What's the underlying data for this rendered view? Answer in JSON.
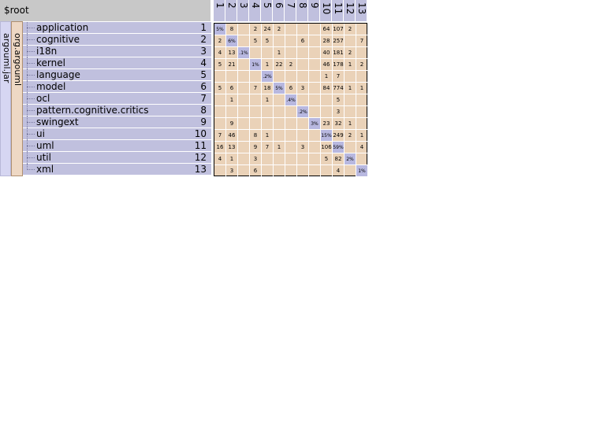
{
  "root_label": "$root",
  "jar_label": "argouml.jar",
  "package_label": "org.argouml",
  "modules": [
    {
      "name": "application",
      "index": "1"
    },
    {
      "name": "cognitive",
      "index": "2"
    },
    {
      "name": "i18n",
      "index": "3"
    },
    {
      "name": "kernel",
      "index": "4"
    },
    {
      "name": "language",
      "index": "5"
    },
    {
      "name": "model",
      "index": "6"
    },
    {
      "name": "ocl",
      "index": "7"
    },
    {
      "name": "pattern.cognitive.critics",
      "index": "8"
    },
    {
      "name": "swingext",
      "index": "9"
    },
    {
      "name": "ui",
      "index": "10"
    },
    {
      "name": "uml",
      "index": "11"
    },
    {
      "name": "util",
      "index": "12"
    },
    {
      "name": "xml",
      "index": "13"
    }
  ],
  "column_headers": [
    "1",
    "2",
    "3",
    "4",
    "5",
    "6",
    "7",
    "8",
    "9",
    "10",
    "11",
    "12",
    "13"
  ],
  "matrix": [
    [
      "5%",
      "8",
      "",
      "2",
      "24",
      "2",
      "",
      "",
      "",
      "64",
      "107",
      "2",
      ""
    ],
    [
      "2",
      "6%",
      "",
      "5",
      "5",
      "",
      "",
      "6",
      "",
      "28",
      "257",
      "",
      "7"
    ],
    [
      "4",
      "13",
      ".1%",
      "",
      "",
      "1",
      "",
      "",
      "",
      "40",
      "181",
      "2",
      ""
    ],
    [
      "5",
      "21",
      "",
      "1%",
      "1",
      "22",
      "2",
      "",
      "",
      "46",
      "178",
      "1",
      "2"
    ],
    [
      "",
      "",
      "",
      "",
      ".2%",
      "",
      "",
      "",
      "",
      "1",
      "7",
      "",
      ""
    ],
    [
      "5",
      "6",
      "",
      "7",
      "18",
      "5%",
      "6",
      "3",
      "",
      "84",
      "774",
      "1",
      "1"
    ],
    [
      "",
      "1",
      "",
      "",
      "1",
      "",
      ".4%",
      "",
      "",
      "",
      "5",
      "",
      ""
    ],
    [
      "",
      "",
      "",
      "",
      "",
      "",
      "",
      ".2%",
      "",
      "",
      "3",
      "",
      ""
    ],
    [
      "",
      "9",
      "",
      "",
      "",
      "",
      "",
      "",
      "3%",
      "23",
      "32",
      "1",
      ""
    ],
    [
      "7",
      "46",
      "",
      "8",
      "1",
      "",
      "",
      "",
      "",
      "15%",
      "249",
      "2",
      "1"
    ],
    [
      "16",
      "13",
      "",
      "9",
      "7",
      "1",
      "",
      "3",
      "",
      "106",
      "59%",
      "",
      "4"
    ],
    [
      "4",
      "1",
      "",
      "3",
      "",
      "",
      "",
      "",
      "",
      "5",
      "82",
      "2%",
      ""
    ],
    [
      "",
      "3",
      "",
      "6",
      "",
      "",
      "",
      "",
      "",
      "",
      "4",
      "",
      "1%"
    ]
  ]
}
